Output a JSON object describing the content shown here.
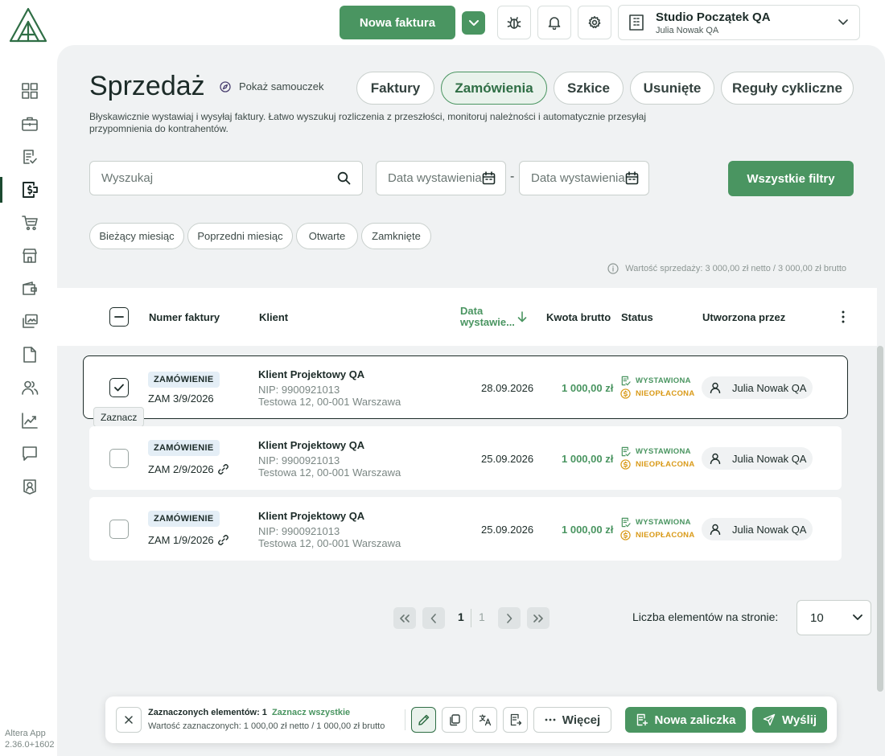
{
  "header": {
    "new_invoice_label": "Nowa faktura",
    "company_name": "Studio Początek QA",
    "company_user": "Julia Nowak QA"
  },
  "sidebar": {
    "version": "Altera App 2.36.0+1602",
    "items": [
      "dashboard-icon",
      "briefcase-icon",
      "document-check-icon",
      "sales-icon",
      "cart-icon",
      "store-icon",
      "wallet-icon",
      "gallery-icon",
      "file-icon",
      "contacts-icon",
      "chart-icon",
      "message-icon",
      "user-badge-icon"
    ],
    "active": "sales-icon"
  },
  "page": {
    "title": "Sprzedaż",
    "tutorial_label": "Pokaż samouczek",
    "description": "Błyskawicznie wystawiaj i wysyłaj faktury. Łatwo wyszukuj rozliczenia z przeszłości, monitoruj należności i automatycznie przesyłaj przypomnienia do kontrahentów.",
    "tabs": [
      {
        "label": "Faktury",
        "active": false
      },
      {
        "label": "Zamówienia",
        "active": true
      },
      {
        "label": "Szkice",
        "active": false
      },
      {
        "label": "Usunięte",
        "active": false
      },
      {
        "label": "Reguły cykliczne",
        "active": false
      }
    ]
  },
  "filters": {
    "search_placeholder": "Wyszukaj",
    "date_from_placeholder": "Data wystawienia",
    "date_to_placeholder": "Data wystawienia",
    "date_separator": "-",
    "all_filters_label": "Wszystkie filtry",
    "chips": [
      "Bieżący miesiąc",
      "Poprzedni miesiąc",
      "Otwarte",
      "Zamknięte"
    ],
    "sales_value": "Wartość sprzedaży: 3 000,00 zł netto / 3 000,00 zł brutto"
  },
  "table": {
    "headers": {
      "number": "Numer faktury",
      "client": "Klient",
      "date_line1": "Data",
      "date_line2": "wystawie...",
      "amount": "Kwota brutto",
      "status": "Status",
      "created_by": "Utworzona przez"
    },
    "rows": [
      {
        "type": "ZAMÓWIENIE",
        "number": "ZAM 3/9/2026",
        "linked": false,
        "client": "Klient Projektowy QA",
        "nip": "NIP: 9900921013",
        "address": "Testowa 12, 00-001 Warszawa",
        "date": "28.09.2026",
        "amount": "1 000,00 zł",
        "status1": "WYSTAWIONA",
        "status2": "NIEOPŁACONA",
        "creator": "Julia Nowak QA",
        "checked": true
      },
      {
        "type": "ZAMÓWIENIE",
        "number": "ZAM 2/9/2026",
        "linked": true,
        "client": "Klient Projektowy QA",
        "nip": "NIP: 9900921013",
        "address": "Testowa 12, 00-001 Warszawa",
        "date": "25.09.2026",
        "amount": "1 000,00 zł",
        "status1": "WYSTAWIONA",
        "status2": "NIEOPŁACONA",
        "creator": "Julia Nowak QA",
        "checked": false
      },
      {
        "type": "ZAMÓWIENIE",
        "number": "ZAM 1/9/2026",
        "linked": true,
        "client": "Klient Projektowy QA",
        "nip": "NIP: 9900921013",
        "address": "Testowa 12, 00-001 Warszawa",
        "date": "25.09.2026",
        "amount": "1 000,00 zł",
        "status1": "WYSTAWIONA",
        "status2": "NIEOPŁACONA",
        "creator": "Julia Nowak QA",
        "checked": false
      }
    ],
    "tooltip": "Zaznacz"
  },
  "pagination": {
    "current_page": "1",
    "total_pages": "1",
    "per_page_label": "Liczba elementów na stronie:",
    "per_page_value": "10"
  },
  "bottom_bar": {
    "selected_label": "Zaznaczonych elementów: 1",
    "select_all_label": "Zaznacz wszystkie",
    "selected_value": "Wartość zaznaczonych: 1 000,00 zł netto / 1 000,00 zł brutto",
    "more_label": "Więcej",
    "new_advance_label": "Nowa zaliczka",
    "send_label": "Wyślij"
  },
  "colors": {
    "accent": "#4a9561",
    "accent_dark": "#2f6e45",
    "status_issued": "#4a9561",
    "status_unpaid": "#d99a18",
    "panel_bg": "#f0f2f3",
    "badge_bg": "#e4eef6"
  }
}
